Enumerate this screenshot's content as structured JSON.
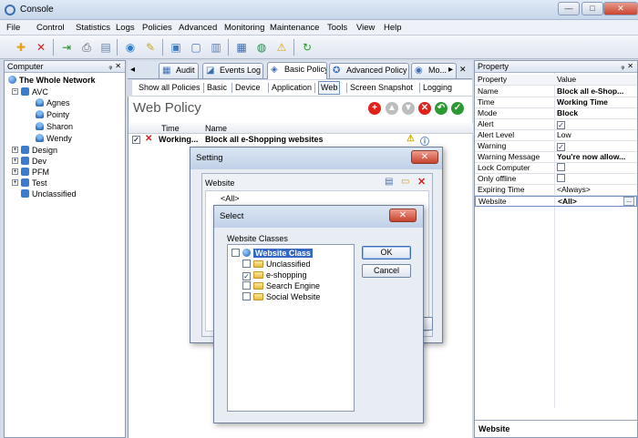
{
  "window": {
    "title": "Console",
    "min_label": "—",
    "max_label": "□",
    "close_label": "✕"
  },
  "menu": [
    "File",
    "Control",
    "Statistics",
    "Logs",
    "Policies",
    "Advanced",
    "Monitoring",
    "Maintenance",
    "Tools",
    "View",
    "Help"
  ],
  "toolbar": {
    "icons": [
      {
        "name": "add-icon",
        "glyph": "✚",
        "color": "#e6a21a"
      },
      {
        "name": "delete-icon",
        "glyph": "✕",
        "color": "#d42020"
      },
      {
        "name": "import-icon",
        "glyph": "⇥",
        "color": "#2a8a2a"
      },
      {
        "name": "print-icon",
        "glyph": "⎙",
        "color": "#555555"
      },
      {
        "name": "print-preview-icon",
        "glyph": "▤",
        "color": "#6a7fa8"
      },
      {
        "name": "globe-icon",
        "glyph": "◉",
        "color": "#2b7bd3"
      },
      {
        "name": "key-icon",
        "glyph": "✎",
        "color": "#c9a227"
      },
      {
        "name": "computers-icon",
        "glyph": "▣",
        "color": "#3f7bc4"
      },
      {
        "name": "monitor-icon",
        "glyph": "▢",
        "color": "#4a78b8"
      },
      {
        "name": "screen-icon",
        "glyph": "▥",
        "color": "#5f7fb0"
      },
      {
        "name": "report-icon",
        "glyph": "▦",
        "color": "#3c6aa8"
      },
      {
        "name": "network-icon",
        "glyph": "◍",
        "color": "#1f8a4a"
      },
      {
        "name": "warning-icon",
        "glyph": "⚠",
        "color": "#d8a800"
      },
      {
        "name": "refresh-icon",
        "glyph": "↻",
        "color": "#2a9a2a"
      }
    ]
  },
  "computer_panel": {
    "title": "Computer",
    "pin": "ᵩ",
    "close": "✕",
    "root": "The Whole Network",
    "groups": [
      {
        "label": "AVC",
        "expanded": true,
        "children": [
          "Agnes",
          "Pointy",
          "Sharon",
          "Wendy"
        ]
      },
      {
        "label": "Design",
        "expanded": false,
        "children": []
      },
      {
        "label": "Dev",
        "expanded": false,
        "children": []
      },
      {
        "label": "PFM",
        "expanded": false,
        "children": []
      },
      {
        "label": "Test",
        "expanded": false,
        "children": []
      },
      {
        "label": "Unclassified",
        "expanded": null,
        "children": []
      }
    ]
  },
  "tabs": {
    "scroll_left": "◂",
    "items": [
      {
        "label": "Audit",
        "icon": "▦"
      },
      {
        "label": "Events Log",
        "icon": "◪"
      },
      {
        "label": "Basic Policy",
        "icon": "◈",
        "active": true
      },
      {
        "label": "Advanced Policy",
        "icon": "✪"
      },
      {
        "label": "Mo...",
        "icon": "◉"
      }
    ],
    "scroll_right": "▸",
    "close": "✕"
  },
  "subtabs": {
    "items": [
      "Show all Policies",
      "Basic",
      "Device",
      "Application",
      "Web",
      "Screen Snapshot",
      "Logging"
    ],
    "active_index": 4
  },
  "policy": {
    "title": "Web Policy",
    "actions": [
      {
        "name": "add-policy-button",
        "glyph": "+",
        "color": "#e0221b"
      },
      {
        "name": "move-up-button",
        "glyph": "▲",
        "color": "#bdbdbd"
      },
      {
        "name": "move-down-button",
        "glyph": "▼",
        "color": "#bdbdbd"
      },
      {
        "name": "delete-policy-button",
        "glyph": "✕",
        "color": "#e0221b"
      },
      {
        "name": "undo-button",
        "glyph": "↶",
        "color": "#2c9a32"
      },
      {
        "name": "apply-button",
        "glyph": "✓",
        "color": "#2c9a32"
      }
    ],
    "columns": {
      "time": "Time",
      "name": "Name"
    },
    "rows": [
      {
        "checked": "✓",
        "mode_icon": "✕",
        "time": "Working...",
        "name": "Block all e-Shopping websites",
        "alert_icon": "⚠",
        "info_icon": "ⓘ"
      }
    ]
  },
  "setting_dialog": {
    "title": "Setting",
    "close": "✕",
    "section_label": "Website",
    "list_items": [
      "<All>"
    ],
    "add_icon": "▤",
    "folder_icon": "▭",
    "delete_icon": "✕"
  },
  "select_dialog": {
    "title": "Select",
    "close": "✕",
    "group_label": "Website Classes",
    "root": {
      "label": "Website Class",
      "checked": false
    },
    "items": [
      {
        "label": "Unclassified",
        "checked": false
      },
      {
        "label": "e-shopping",
        "checked": true
      },
      {
        "label": "Search Engine",
        "checked": false
      },
      {
        "label": "Social Website",
        "checked": false
      }
    ],
    "ok_label": "OK",
    "cancel_label": "Cancel"
  },
  "property_panel": {
    "title": "Property",
    "pin": "ᵩ",
    "close": "✕",
    "col_property": "Property",
    "col_value": "Value",
    "rows": [
      {
        "name": "Name",
        "value": "Block all e-Shop...",
        "bold": true
      },
      {
        "name": "Time",
        "value": "Working Time",
        "bold": true
      },
      {
        "name": "Mode",
        "value": "Block",
        "bold": true
      },
      {
        "name": "Alert",
        "value": "☑",
        "type": "check",
        "checked": true
      },
      {
        "name": "Alert Level",
        "value": "Low",
        "bold": false
      },
      {
        "name": "Warning",
        "value": "☑",
        "type": "check",
        "checked": true
      },
      {
        "name": "Warning Message",
        "value": "You're now allow...",
        "bold": true
      },
      {
        "name": "Lock Computer",
        "value": "☐",
        "type": "check",
        "checked": false
      },
      {
        "name": "Only offline",
        "value": "☐",
        "type": "check",
        "checked": false
      },
      {
        "name": "Expiring Time",
        "value": "<Always>",
        "bold": false
      },
      {
        "name": "Website",
        "value": "<All>",
        "bold": true,
        "selected": true,
        "ellipsis": "..."
      }
    ],
    "footer_label": "Website"
  }
}
